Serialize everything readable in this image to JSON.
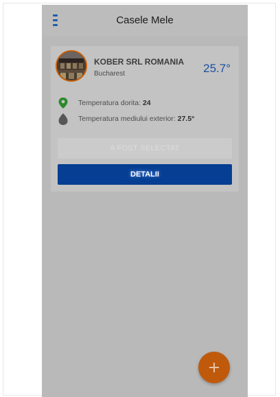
{
  "app": {
    "title": "Casele Mele"
  },
  "home_card": {
    "name": "KOBER SRL ROMANIA",
    "city": "Bucharest",
    "current_temperature": "25.7°",
    "desired_temperature_label": "Temperatura dorita:",
    "desired_temperature_value": "24",
    "outside_temperature_label": "Temperatura mediului exterior:",
    "outside_temperature_value": "27.5°",
    "selected_button_label": "A FOST SELECTAT",
    "details_button_label": "DETALII"
  },
  "icons": {
    "menu": "menu-icon",
    "location": "location-pin-icon",
    "outside": "leaf-icon",
    "fab": "plus-icon"
  },
  "colors": {
    "accent_blue": "#053e92",
    "temperature_blue": "#1d4fa0",
    "fab_orange": "#bf5a0d",
    "pin_green": "#2a8a2a",
    "overlay_gray": "#b9b9b9"
  }
}
